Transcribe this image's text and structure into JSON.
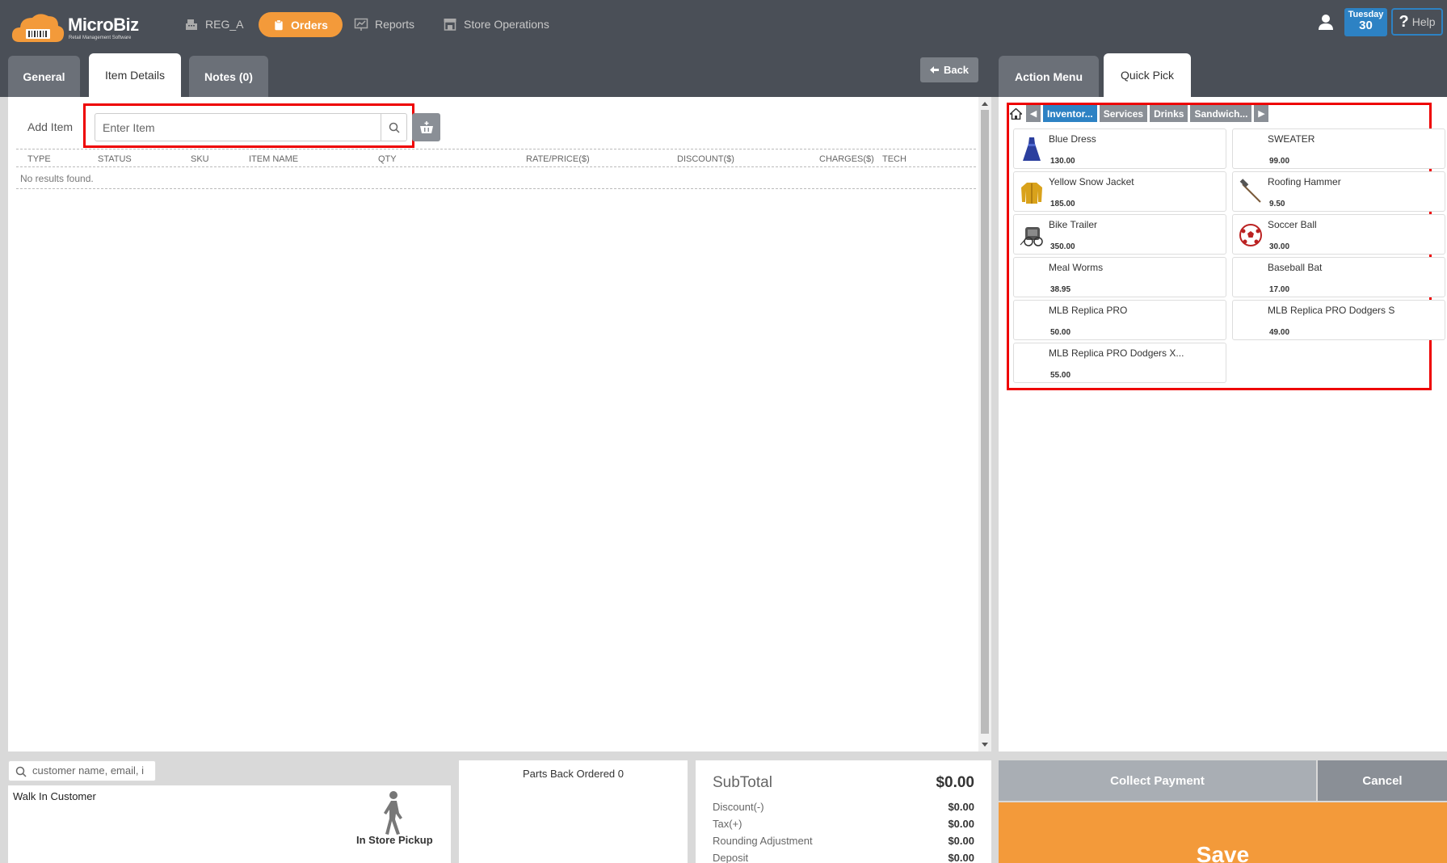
{
  "brand": {
    "name": "MicroBiz",
    "tagline": "Retail Management Software",
    "logo_icon": "cloud-barcode-icon"
  },
  "nav": {
    "register": "REG_A",
    "orders": "Orders",
    "reports": "Reports",
    "store_operations": "Store Operations"
  },
  "header": {
    "date_dow": "Tuesday",
    "date_day": "30",
    "help": "Help",
    "back": "Back"
  },
  "tabs_left": [
    {
      "label": "General",
      "active": false
    },
    {
      "label": "Item Details",
      "active": true
    },
    {
      "label": "Notes (0)",
      "active": false
    }
  ],
  "tabs_right": [
    {
      "label": "Action Menu",
      "active": false
    },
    {
      "label": "Quick Pick",
      "active": true
    }
  ],
  "item_details": {
    "add_item_label": "Add Item",
    "search_placeholder": "Enter Item",
    "columns": [
      "TYPE",
      "STATUS",
      "SKU",
      "ITEM NAME",
      "QTY",
      "RATE/PRICE($)",
      "DISCOUNT($)",
      "CHARGES($)",
      "TECH"
    ],
    "empty_text": "No results found."
  },
  "quick_pick": {
    "categories": [
      {
        "label": "Inventor...",
        "active": true
      },
      {
        "label": "Services",
        "active": false
      },
      {
        "label": "Drinks",
        "active": false
      },
      {
        "label": "Sandwich...",
        "active": false
      }
    ],
    "items": [
      {
        "name": "Blue Dress",
        "price": "130.00",
        "icon": "blue-dress-icon"
      },
      {
        "name": "SWEATER",
        "price": "99.00",
        "icon": ""
      },
      {
        "name": "Yellow Snow Jacket",
        "price": "185.00",
        "icon": "yellow-jacket-icon"
      },
      {
        "name": "Roofing Hammer",
        "price": "9.50",
        "icon": "hammer-icon"
      },
      {
        "name": "Bike Trailer",
        "price": "350.00",
        "icon": "bike-trailer-icon"
      },
      {
        "name": "Soccer Ball",
        "price": "30.00",
        "icon": "soccer-ball-icon"
      },
      {
        "name": "Meal Worms",
        "price": "38.95",
        "icon": ""
      },
      {
        "name": "Baseball Bat",
        "price": "17.00",
        "icon": ""
      },
      {
        "name": "MLB Replica PRO",
        "price": "50.00",
        "icon": ""
      },
      {
        "name": "MLB Replica PRO Dodgers S",
        "price": "49.00",
        "icon": ""
      },
      {
        "name": "MLB Replica PRO Dodgers X...",
        "price": "55.00",
        "icon": ""
      }
    ]
  },
  "customer": {
    "search_placeholder": "customer name, email, i",
    "name": "Walk In Customer",
    "pickup": "In Store Pickup"
  },
  "parts": {
    "title": "Parts Back Ordered 0"
  },
  "totals": {
    "subtotal_label": "SubTotal",
    "subtotal": "$0.00",
    "discount_label": "Discount(-)",
    "discount": "$0.00",
    "tax_label": "Tax(+)",
    "tax": "$0.00",
    "rounding_label": "Rounding Adjustment",
    "rounding": "$0.00",
    "deposit_label": "Deposit",
    "deposit": "$0.00"
  },
  "actions": {
    "collect_payment": "Collect Payment",
    "cancel": "Cancel",
    "save": "Save"
  },
  "colors": {
    "topbar": "#4a4f57",
    "accent_orange": "#f39a3a",
    "accent_blue": "#2d82c4",
    "highlight_red": "#e00000"
  }
}
